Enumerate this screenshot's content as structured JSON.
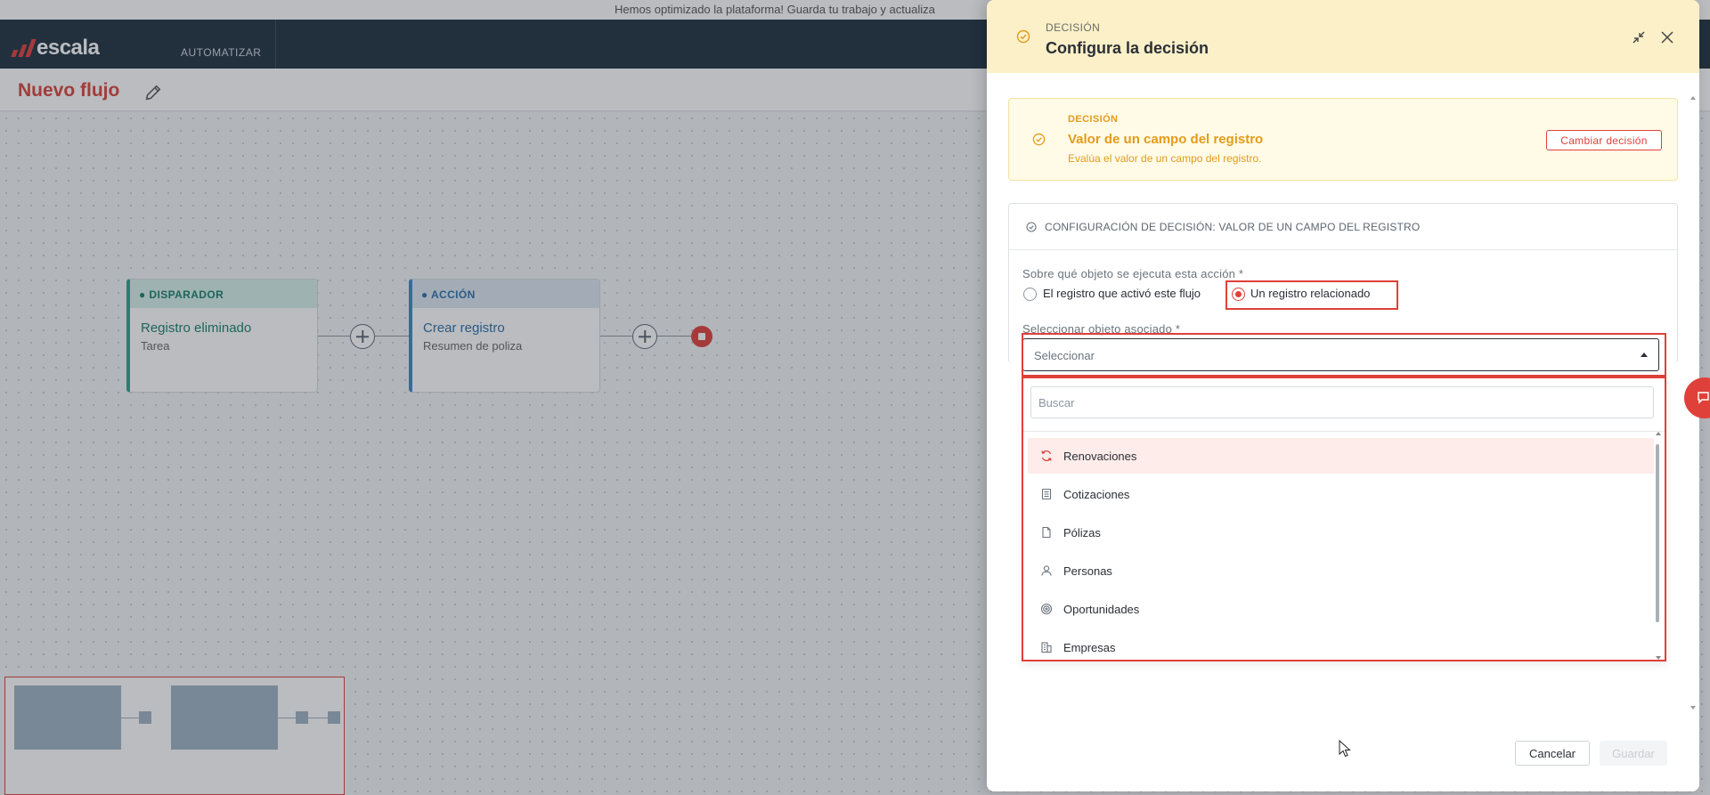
{
  "banner": {
    "text": "Hemos optimizado la plataforma! Guarda tu trabajo y actualiza"
  },
  "app": {
    "logo_text": "escala",
    "nav_item": "AUTOMATIZAR"
  },
  "flow": {
    "title": "Nuevo flujo",
    "nodes": [
      {
        "kind": "DISPARADOR",
        "title": "Registro eliminado",
        "subtitle": "Tarea"
      },
      {
        "kind": "ACCIÓN",
        "title": "Crear registro",
        "subtitle": "Resumen de poliza"
      }
    ]
  },
  "panel": {
    "kicker": "DECISIÓN",
    "title": "Configura la decisión",
    "decision": {
      "kicker": "DECISIÓN",
      "title": "Valor de un campo del registro",
      "description": "Evalúa el valor de un campo del registro.",
      "change_label": "Cambiar decisión"
    },
    "config": {
      "title": "CONFIGURACIÓN DE DECISIÓN: VALOR DE UN CAMPO DEL REGISTRO",
      "object_question": "Sobre qué objeto se ejecuta esta acción *",
      "radio_options": [
        {
          "label": "El registro que activó este flujo",
          "selected": false
        },
        {
          "label": "Un registro relacionado",
          "selected": true
        }
      ],
      "select_label": "Seleccionar objeto asociado *",
      "select_value": "Seleccionar",
      "search_placeholder": "Buscar",
      "options": [
        {
          "label": "Renovaciones",
          "icon": "refresh-icon"
        },
        {
          "label": "Cotizaciones",
          "icon": "document-list-icon"
        },
        {
          "label": "Pólizas",
          "icon": "file-icon"
        },
        {
          "label": "Personas",
          "icon": "person-icon"
        },
        {
          "label": "Oportunidades",
          "icon": "target-icon"
        },
        {
          "label": "Empresas",
          "icon": "building-icon"
        }
      ]
    },
    "footer": {
      "cancel_label": "Cancelar",
      "save_label": "Guardar"
    }
  },
  "colors": {
    "brand": "#e0403a",
    "header_bg": "#fbf0c8",
    "decision_accent": "#e39b1b",
    "nav_bg": "#1f3140"
  }
}
